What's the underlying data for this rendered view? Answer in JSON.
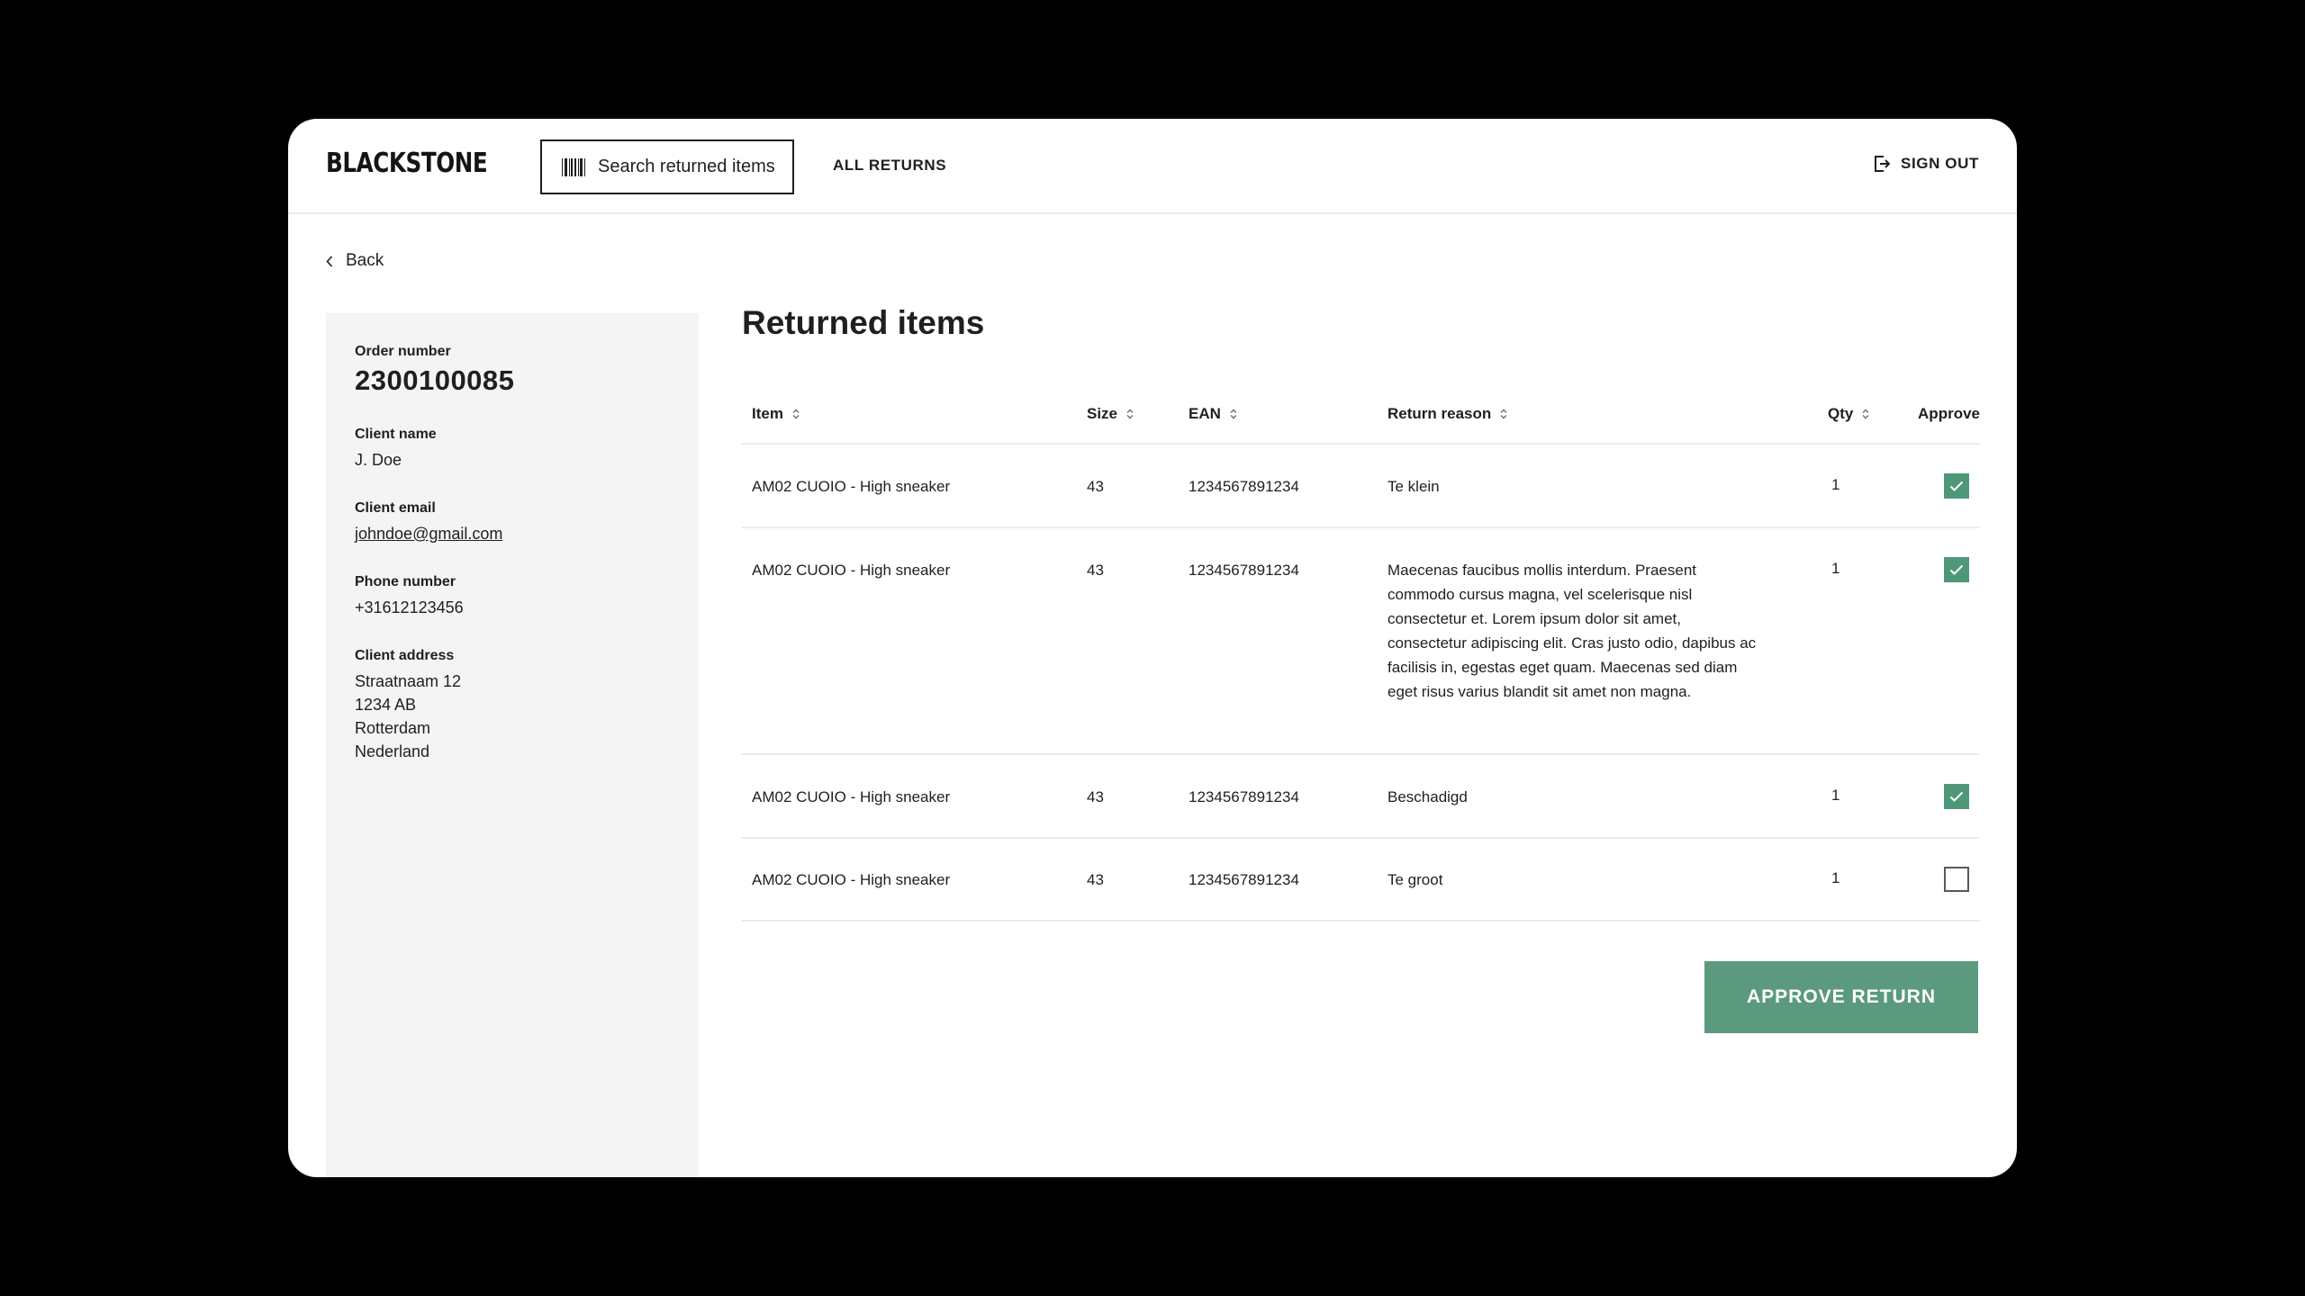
{
  "header": {
    "logo": "BLACKSTONE",
    "search_label": "Search returned items",
    "nav_all_returns": "ALL RETURNS",
    "sign_out": "SIGN OUT"
  },
  "back_label": "Back",
  "sidebar": {
    "order_number_label": "Order number",
    "order_number": "2300100085",
    "client_name_label": "Client name",
    "client_name": "J. Doe",
    "client_email_label": "Client email",
    "client_email": "johndoe@gmail.com",
    "phone_label": "Phone number",
    "phone": "+31612123456",
    "address_label": "Client address",
    "address_lines": [
      "Straatnaam 12",
      "1234 AB",
      "Rotterdam",
      "Nederland"
    ]
  },
  "main": {
    "title": "Returned items",
    "columns": {
      "item": "Item",
      "size": "Size",
      "ean": "EAN",
      "reason": "Return reason",
      "qty": "Qty",
      "approve": "Approve"
    },
    "rows": [
      {
        "item": "AM02 CUOIO - High sneaker",
        "size": "43",
        "ean": "1234567891234",
        "reason": "Te klein",
        "qty": "1",
        "approved": true
      },
      {
        "item": "AM02 CUOIO - High sneaker",
        "size": "43",
        "ean": "1234567891234",
        "reason": "Maecenas faucibus mollis interdum. Praesent commodo cursus magna, vel scelerisque nisl consectetur et. Lorem ipsum dolor sit amet, consectetur adipiscing elit. Cras justo odio, dapibus ac facilisis in, egestas eget quam. Maecenas sed diam eget risus varius blandit sit amet non magna.",
        "qty": "1",
        "approved": true
      },
      {
        "item": "AM02 CUOIO - High sneaker",
        "size": "43",
        "ean": "1234567891234",
        "reason": "Beschadigd",
        "qty": "1",
        "approved": true
      },
      {
        "item": "AM02 CUOIO - High sneaker",
        "size": "43",
        "ean": "1234567891234",
        "reason": "Te groot",
        "qty": "1",
        "approved": false
      }
    ],
    "approve_button": "APPROVE RETURN"
  },
  "colors": {
    "accent": "#5b9a7f",
    "checkbox_checked": "#4f9779",
    "sidebar_bg": "#f4f4f4"
  }
}
